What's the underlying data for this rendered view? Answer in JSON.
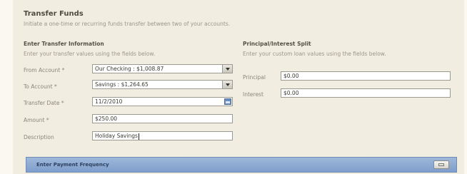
{
  "header": {
    "title": "Transfer Funds",
    "subtitle": "Initiate a one-time or recurring funds transfer between two of your accounts."
  },
  "transfer_info": {
    "heading": "Enter Transfer Information",
    "description": "Enter your transfer values using the fields below.",
    "from_account": {
      "label": "From Account *",
      "value": "Our Checking : $1,008.87"
    },
    "to_account": {
      "label": "To Account *",
      "value": "Savings : $1,264.65"
    },
    "transfer_date": {
      "label": "Transfer Date *",
      "value": "11/2/2010"
    },
    "amount": {
      "label": "Amount *",
      "value": "$250.00"
    },
    "description_field": {
      "label": "Description",
      "value": "Holiday Savings"
    }
  },
  "split": {
    "heading": "Principal/Interest Split",
    "description": "Enter your custom loan values using the fields below.",
    "principal": {
      "label": "Principal",
      "value": "$0.00"
    },
    "interest": {
      "label": "Interest",
      "value": "$0.00"
    }
  },
  "payment_frequency": {
    "label": "Enter Payment Frequency"
  }
}
